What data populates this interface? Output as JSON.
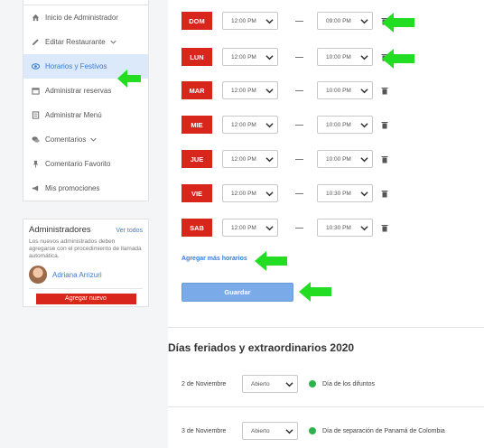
{
  "sidebar": {
    "items": [
      {
        "label": "Inicio de Administrador",
        "icon": "home-icon"
      },
      {
        "label": "Editar Restaurante",
        "icon": "pencil-icon",
        "expandable": true
      },
      {
        "label": "Horarios y Festivos",
        "icon": "eye-icon",
        "active": true
      },
      {
        "label": "Administrar reservas",
        "icon": "calendar-icon"
      },
      {
        "label": "Administrar Menú",
        "icon": "menu-list-icon"
      },
      {
        "label": "Comentarios",
        "icon": "comments-icon",
        "expandable": true
      },
      {
        "label": "Comentario Favorito",
        "icon": "pin-icon"
      },
      {
        "label": "Mis promociones",
        "icon": "megaphone-icon"
      }
    ]
  },
  "admins": {
    "title": "Administradores",
    "view_all": "Ver todos",
    "description": "Los nuevos administrados deben agregarse con el procedimiento de llamada automática.",
    "person_name": "Adriana Arrizuri",
    "add_button": "Agregar nuevo"
  },
  "schedule": {
    "rows": [
      {
        "day": "DOM",
        "open": "12:00 PM",
        "close": "09:00 PM"
      },
      {
        "day": "LUN",
        "open": "12:00 PM",
        "close": "10:00 PM"
      },
      {
        "day": "MAR",
        "open": "12:00 PM",
        "close": "10:00 PM"
      },
      {
        "day": "MIE",
        "open": "12:00 PM",
        "close": "10:00 PM"
      },
      {
        "day": "JUE",
        "open": "12:00 PM",
        "close": "10:00 PM"
      },
      {
        "day": "VIE",
        "open": "12:00 PM",
        "close": "10:30 PM"
      },
      {
        "day": "SAB",
        "open": "12:00 PM",
        "close": "10:30 PM"
      }
    ],
    "add_more": "Agregar más horarios",
    "save": "Guardar"
  },
  "holidays": {
    "title": "Días feriados y extraordinarios 2020",
    "items": [
      {
        "date": "2 de Noviembre",
        "status": "Abierto",
        "name": "Día de los difuntos",
        "status_color": "#2cb24a"
      },
      {
        "date": "3 de Noviembre",
        "status": "Abierto",
        "name": "Día de separación de Panamá de Colombia",
        "status_color": "#2cb24a"
      }
    ]
  },
  "colors": {
    "accent_red": "#d9261c",
    "link_blue": "#3a7bd5",
    "save_blue": "#7aaae8",
    "annotation_green": "#22dd22"
  }
}
